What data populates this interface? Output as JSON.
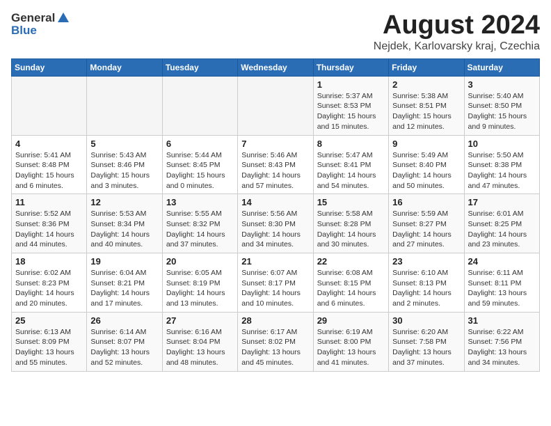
{
  "header": {
    "logo_general": "General",
    "logo_blue": "Blue",
    "main_title": "August 2024",
    "subtitle": "Nejdek, Karlovarsky kraj, Czechia"
  },
  "calendar": {
    "headers": [
      "Sunday",
      "Monday",
      "Tuesday",
      "Wednesday",
      "Thursday",
      "Friday",
      "Saturday"
    ],
    "weeks": [
      [
        {
          "day": "",
          "info": ""
        },
        {
          "day": "",
          "info": ""
        },
        {
          "day": "",
          "info": ""
        },
        {
          "day": "",
          "info": ""
        },
        {
          "day": "1",
          "info": "Sunrise: 5:37 AM\nSunset: 8:53 PM\nDaylight: 15 hours\nand 15 minutes."
        },
        {
          "day": "2",
          "info": "Sunrise: 5:38 AM\nSunset: 8:51 PM\nDaylight: 15 hours\nand 12 minutes."
        },
        {
          "day": "3",
          "info": "Sunrise: 5:40 AM\nSunset: 8:50 PM\nDaylight: 15 hours\nand 9 minutes."
        }
      ],
      [
        {
          "day": "4",
          "info": "Sunrise: 5:41 AM\nSunset: 8:48 PM\nDaylight: 15 hours\nand 6 minutes."
        },
        {
          "day": "5",
          "info": "Sunrise: 5:43 AM\nSunset: 8:46 PM\nDaylight: 15 hours\nand 3 minutes."
        },
        {
          "day": "6",
          "info": "Sunrise: 5:44 AM\nSunset: 8:45 PM\nDaylight: 15 hours\nand 0 minutes."
        },
        {
          "day": "7",
          "info": "Sunrise: 5:46 AM\nSunset: 8:43 PM\nDaylight: 14 hours\nand 57 minutes."
        },
        {
          "day": "8",
          "info": "Sunrise: 5:47 AM\nSunset: 8:41 PM\nDaylight: 14 hours\nand 54 minutes."
        },
        {
          "day": "9",
          "info": "Sunrise: 5:49 AM\nSunset: 8:40 PM\nDaylight: 14 hours\nand 50 minutes."
        },
        {
          "day": "10",
          "info": "Sunrise: 5:50 AM\nSunset: 8:38 PM\nDaylight: 14 hours\nand 47 minutes."
        }
      ],
      [
        {
          "day": "11",
          "info": "Sunrise: 5:52 AM\nSunset: 8:36 PM\nDaylight: 14 hours\nand 44 minutes."
        },
        {
          "day": "12",
          "info": "Sunrise: 5:53 AM\nSunset: 8:34 PM\nDaylight: 14 hours\nand 40 minutes."
        },
        {
          "day": "13",
          "info": "Sunrise: 5:55 AM\nSunset: 8:32 PM\nDaylight: 14 hours\nand 37 minutes."
        },
        {
          "day": "14",
          "info": "Sunrise: 5:56 AM\nSunset: 8:30 PM\nDaylight: 14 hours\nand 34 minutes."
        },
        {
          "day": "15",
          "info": "Sunrise: 5:58 AM\nSunset: 8:28 PM\nDaylight: 14 hours\nand 30 minutes."
        },
        {
          "day": "16",
          "info": "Sunrise: 5:59 AM\nSunset: 8:27 PM\nDaylight: 14 hours\nand 27 minutes."
        },
        {
          "day": "17",
          "info": "Sunrise: 6:01 AM\nSunset: 8:25 PM\nDaylight: 14 hours\nand 23 minutes."
        }
      ],
      [
        {
          "day": "18",
          "info": "Sunrise: 6:02 AM\nSunset: 8:23 PM\nDaylight: 14 hours\nand 20 minutes."
        },
        {
          "day": "19",
          "info": "Sunrise: 6:04 AM\nSunset: 8:21 PM\nDaylight: 14 hours\nand 17 minutes."
        },
        {
          "day": "20",
          "info": "Sunrise: 6:05 AM\nSunset: 8:19 PM\nDaylight: 14 hours\nand 13 minutes."
        },
        {
          "day": "21",
          "info": "Sunrise: 6:07 AM\nSunset: 8:17 PM\nDaylight: 14 hours\nand 10 minutes."
        },
        {
          "day": "22",
          "info": "Sunrise: 6:08 AM\nSunset: 8:15 PM\nDaylight: 14 hours\nand 6 minutes."
        },
        {
          "day": "23",
          "info": "Sunrise: 6:10 AM\nSunset: 8:13 PM\nDaylight: 14 hours\nand 2 minutes."
        },
        {
          "day": "24",
          "info": "Sunrise: 6:11 AM\nSunset: 8:11 PM\nDaylight: 13 hours\nand 59 minutes."
        }
      ],
      [
        {
          "day": "25",
          "info": "Sunrise: 6:13 AM\nSunset: 8:09 PM\nDaylight: 13 hours\nand 55 minutes."
        },
        {
          "day": "26",
          "info": "Sunrise: 6:14 AM\nSunset: 8:07 PM\nDaylight: 13 hours\nand 52 minutes."
        },
        {
          "day": "27",
          "info": "Sunrise: 6:16 AM\nSunset: 8:04 PM\nDaylight: 13 hours\nand 48 minutes."
        },
        {
          "day": "28",
          "info": "Sunrise: 6:17 AM\nSunset: 8:02 PM\nDaylight: 13 hours\nand 45 minutes."
        },
        {
          "day": "29",
          "info": "Sunrise: 6:19 AM\nSunset: 8:00 PM\nDaylight: 13 hours\nand 41 minutes."
        },
        {
          "day": "30",
          "info": "Sunrise: 6:20 AM\nSunset: 7:58 PM\nDaylight: 13 hours\nand 37 minutes."
        },
        {
          "day": "31",
          "info": "Sunrise: 6:22 AM\nSunset: 7:56 PM\nDaylight: 13 hours\nand 34 minutes."
        }
      ]
    ]
  }
}
